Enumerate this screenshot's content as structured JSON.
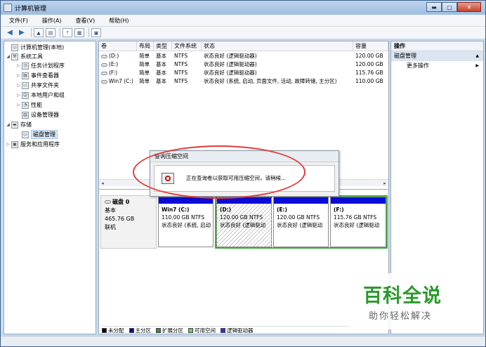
{
  "window": {
    "title": "计算机管理",
    "minimize_glyph": "▬",
    "maximize_glyph": "□",
    "close_glyph": "✕"
  },
  "menubar": [
    "文件(F)",
    "操作(A)",
    "查看(V)",
    "帮助(H)"
  ],
  "toolbar": {
    "icons": [
      "back-arrow-icon",
      "forward-arrow-icon",
      "folder-up-icon",
      "show-tree-icon",
      "help-icon",
      "properties-icon",
      "disk-properties-icon"
    ]
  },
  "tree": {
    "root": "计算机管理(本地)",
    "system_tools": "系统工具",
    "task_scheduler": "任务计划程序",
    "event_viewer": "事件查看器",
    "shared_folders": "共享文件夹",
    "local_users": "本地用户和组",
    "performance": "性能",
    "device_manager": "设备管理器",
    "storage": "存储",
    "disk_management": "磁盘管理",
    "services_apps": "服务和应用程序"
  },
  "volumes": {
    "headers": [
      "卷",
      "布局",
      "类型",
      "文件系统",
      "状态",
      "容量"
    ],
    "rows": [
      [
        "(D:)",
        "简单",
        "基本",
        "NTFS",
        "状态良好 (逻辑驱动器)",
        "120.00 GB"
      ],
      [
        "(E:)",
        "简单",
        "基本",
        "NTFS",
        "状态良好 (逻辑驱动器)",
        "120.00 GB"
      ],
      [
        "(F:)",
        "简单",
        "基本",
        "NTFS",
        "状态良好 (逻辑驱动器)",
        "115.76 GB"
      ],
      [
        "Win7 (C:)",
        "简单",
        "基本",
        "NTFS",
        "状态良好 (系统, 启动, 页面文件, 活动, 故障转储, 主分区)",
        "110.00 GB"
      ]
    ]
  },
  "disk": {
    "name": "磁盘 0",
    "type": "基本",
    "size": "465.76 GB",
    "status": "联机",
    "partitions": [
      {
        "name": "Win7  (C:)",
        "size": "110.00 GB NTFS",
        "status": "状态良好 (系统, 启动",
        "bar_color": "#0b0bd8"
      },
      {
        "name": "(D:)",
        "size": "120.00 GB NTFS",
        "status": "状态良好 (逻辑驱动",
        "bar_color": "#0b0bd8"
      },
      {
        "name": "(E:)",
        "size": "120.00 GB NTFS",
        "status": "状态良好 (逻辑驱动",
        "bar_color": "#0b0bd8"
      },
      {
        "name": "(F:)",
        "size": "115.76 GB NTFS",
        "status": "状态良好 (逻辑驱动",
        "bar_color": "#0b0bd8"
      }
    ]
  },
  "legend": [
    {
      "label": "未分配",
      "color": "#000000"
    },
    {
      "label": "主分区",
      "color": "#0b0b8a"
    },
    {
      "label": "扩展分区",
      "color": "#3a8a3a"
    },
    {
      "label": "可用空间",
      "color": "#5ad65a"
    },
    {
      "label": "逻辑驱动器",
      "color": "#2a2aff"
    }
  ],
  "actions": {
    "header": "操作",
    "section": "磁盘管理",
    "more": "更多操作"
  },
  "dialog": {
    "title": "查询压缩空间",
    "message": "正在查询卷以获取可用压缩空间，请稍候..."
  },
  "watermark": {
    "brand": "百科全说",
    "tagline": "助你轻松解决"
  }
}
